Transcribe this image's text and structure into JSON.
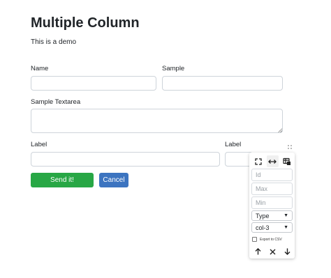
{
  "page": {
    "title": "Multiple Column",
    "subtitle": "This is a demo"
  },
  "form": {
    "name_label": "Name",
    "sample_label": "Sample",
    "textarea_label": "Sample Textarea",
    "label1": "Label",
    "label2": "Label",
    "send_label": "Send it!",
    "cancel_label": "Cancel"
  },
  "colors": {
    "send_button": "#28a745",
    "cancel_button": "#3c74c0"
  },
  "column_panel": {
    "icons": [
      "expand-icon",
      "horizontal-arrows-icon",
      "export-table-icon"
    ],
    "id_placeholder": "Id",
    "max_placeholder": "Max",
    "min_placeholder": "Min",
    "type_select": "Type",
    "col_select": "col-3",
    "export_label": "Export to CSV",
    "export_checked": false,
    "actions": [
      "arrow-up-icon",
      "close-icon",
      "arrow-down-icon"
    ]
  }
}
